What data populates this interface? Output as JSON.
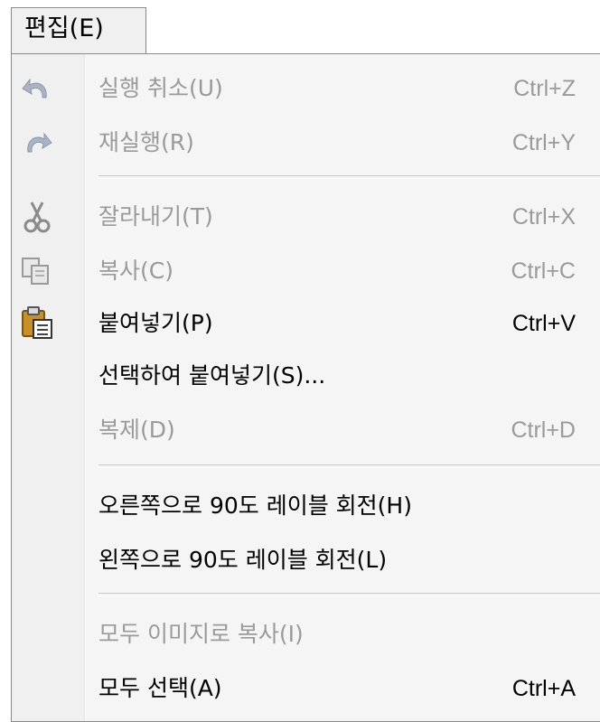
{
  "menu": {
    "title": "편집(E)"
  },
  "items": [
    {
      "label": "실행 취소(U)",
      "shortcut": "Ctrl+Z",
      "icon": "undo-icon",
      "enabled": false
    },
    {
      "label": "재실행(R)",
      "shortcut": "Ctrl+Y",
      "icon": "redo-icon",
      "enabled": false
    },
    {
      "label": "잘라내기(T)",
      "shortcut": "Ctrl+X",
      "icon": "scissors-icon",
      "enabled": false
    },
    {
      "label": "복사(C)",
      "shortcut": "Ctrl+C",
      "icon": "copy-icon",
      "enabled": false
    },
    {
      "label": "붙여넣기(P)",
      "shortcut": "Ctrl+V",
      "icon": "clipboard-paste-icon",
      "enabled": true
    },
    {
      "label": "선택하여 붙여넣기(S)...",
      "shortcut": "",
      "icon": "",
      "enabled": true
    },
    {
      "label": "복제(D)",
      "shortcut": "Ctrl+D",
      "icon": "",
      "enabled": false
    },
    {
      "label": "오른쪽으로 90도 레이블 회전(H)",
      "shortcut": "",
      "icon": "",
      "enabled": true
    },
    {
      "label": "왼쪽으로 90도 레이블 회전(L)",
      "shortcut": "",
      "icon": "",
      "enabled": true
    },
    {
      "label": "모두 이미지로 복사(I)",
      "shortcut": "",
      "icon": "",
      "enabled": false
    },
    {
      "label": "모두 선택(A)",
      "shortcut": "Ctrl+A",
      "icon": "",
      "enabled": true
    }
  ],
  "colors": {
    "enabled_text": "#000000",
    "disabled_text": "#9a9a9a",
    "menu_background": "#f5f5f5",
    "gutter_background": "#f0f0f0"
  }
}
